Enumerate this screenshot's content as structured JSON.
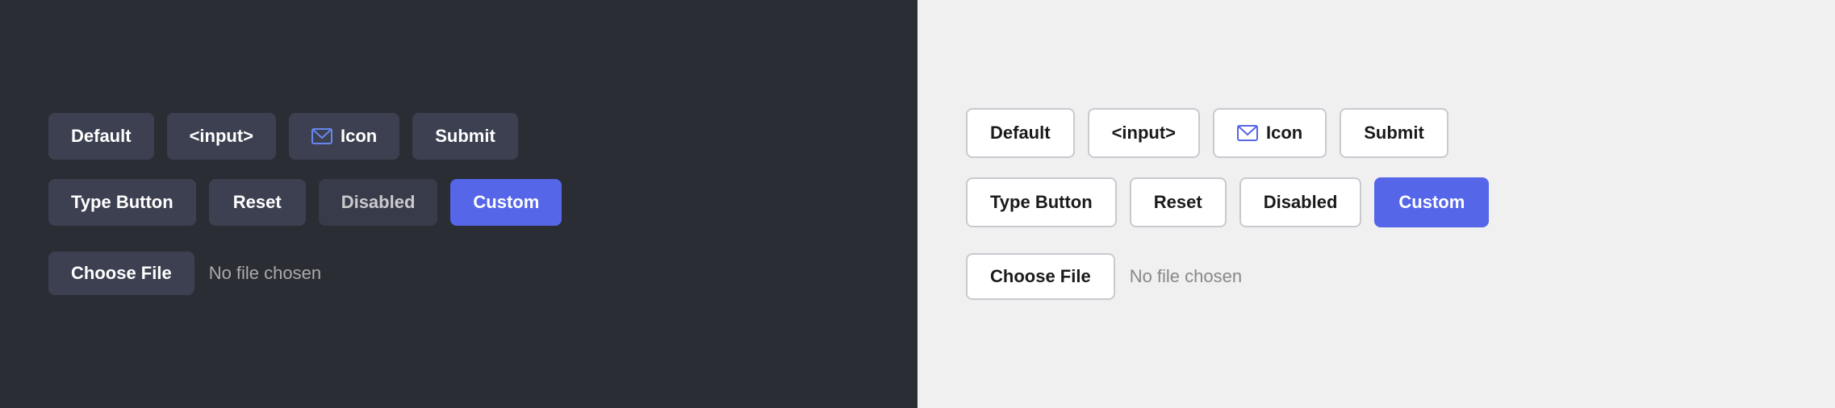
{
  "dark_panel": {
    "bg": "#2b2d35",
    "rows": [
      {
        "buttons": [
          {
            "label": "Default",
            "type": "default"
          },
          {
            "label": "<input>",
            "type": "input"
          },
          {
            "label": "Icon",
            "type": "icon"
          },
          {
            "label": "Submit",
            "type": "submit"
          }
        ]
      },
      {
        "buttons": [
          {
            "label": "Type Button",
            "type": "typebutton"
          },
          {
            "label": "Reset",
            "type": "reset"
          },
          {
            "label": "Disabled",
            "type": "disabled"
          },
          {
            "label": "Custom",
            "type": "custom"
          }
        ]
      }
    ],
    "file": {
      "button_label": "Choose File",
      "file_text": "No file chosen"
    }
  },
  "light_panel": {
    "bg": "#f0f0f0",
    "rows": [
      {
        "buttons": [
          {
            "label": "Default",
            "type": "default"
          },
          {
            "label": "<input>",
            "type": "input"
          },
          {
            "label": "Icon",
            "type": "icon"
          },
          {
            "label": "Submit",
            "type": "submit"
          }
        ]
      },
      {
        "buttons": [
          {
            "label": "Type Button",
            "type": "typebutton"
          },
          {
            "label": "Reset",
            "type": "reset"
          },
          {
            "label": "Disabled",
            "type": "disabled"
          },
          {
            "label": "Custom",
            "type": "custom"
          }
        ]
      }
    ],
    "file": {
      "button_label": "Choose File",
      "file_text": "No file chosen"
    }
  }
}
